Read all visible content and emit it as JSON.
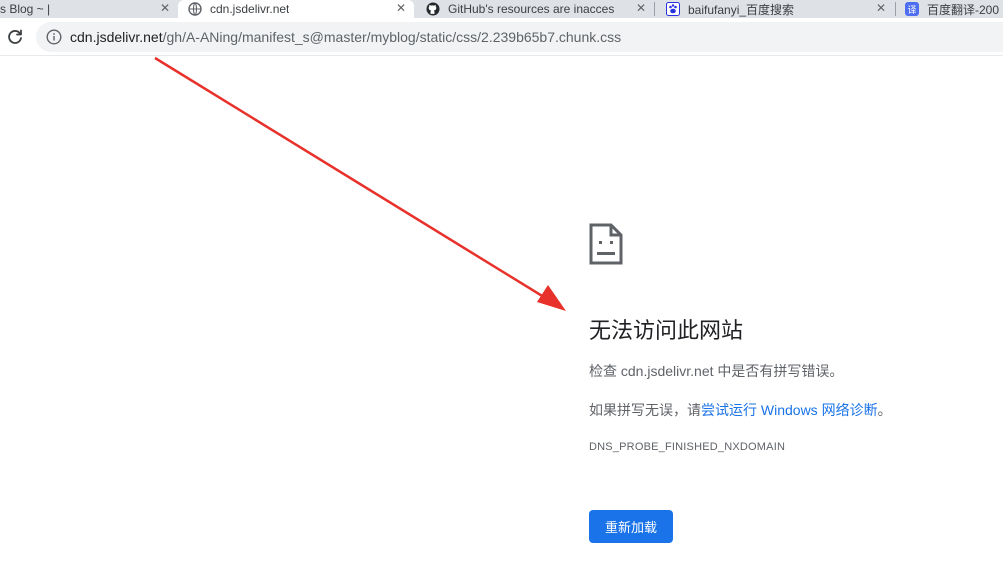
{
  "tabs": [
    {
      "title": "s Blog ~ |",
      "active": false
    },
    {
      "title": "cdn.jsdelivr.net",
      "active": true
    },
    {
      "title": "GitHub's resources are inacces",
      "active": false
    },
    {
      "title": "baifufanyi_百度搜索",
      "active": false
    },
    {
      "title": "百度翻译-200",
      "active": false
    }
  ],
  "omnibox": {
    "host": "cdn.jsdelivr.net",
    "path": "/gh/A-ANing/manifest_s@master/myblog/static/css/2.239b65b7.chunk.css"
  },
  "error": {
    "title": "无法访问此网站",
    "line1": "检查 cdn.jsdelivr.net 中是否有拼写错误。",
    "line2_prefix": "如果拼写无误，请",
    "line2_link": "尝试运行 Windows 网络诊断",
    "line2_suffix": "。",
    "code": "DNS_PROBE_FINISHED_NXDOMAIN",
    "reload_label": "重新加载"
  },
  "icons": {
    "reload": "reload-icon",
    "info": "info-icon",
    "sad_page": "sad-page-icon",
    "globe": "globe-icon",
    "github": "github-icon",
    "baidu": "baidu-paw-icon",
    "baidu_translate": "baidu-translate-icon",
    "close": "close-icon"
  },
  "colors": {
    "link": "#1a73e8",
    "button": "#1a73e8",
    "annotation_arrow": "#e8312b"
  }
}
